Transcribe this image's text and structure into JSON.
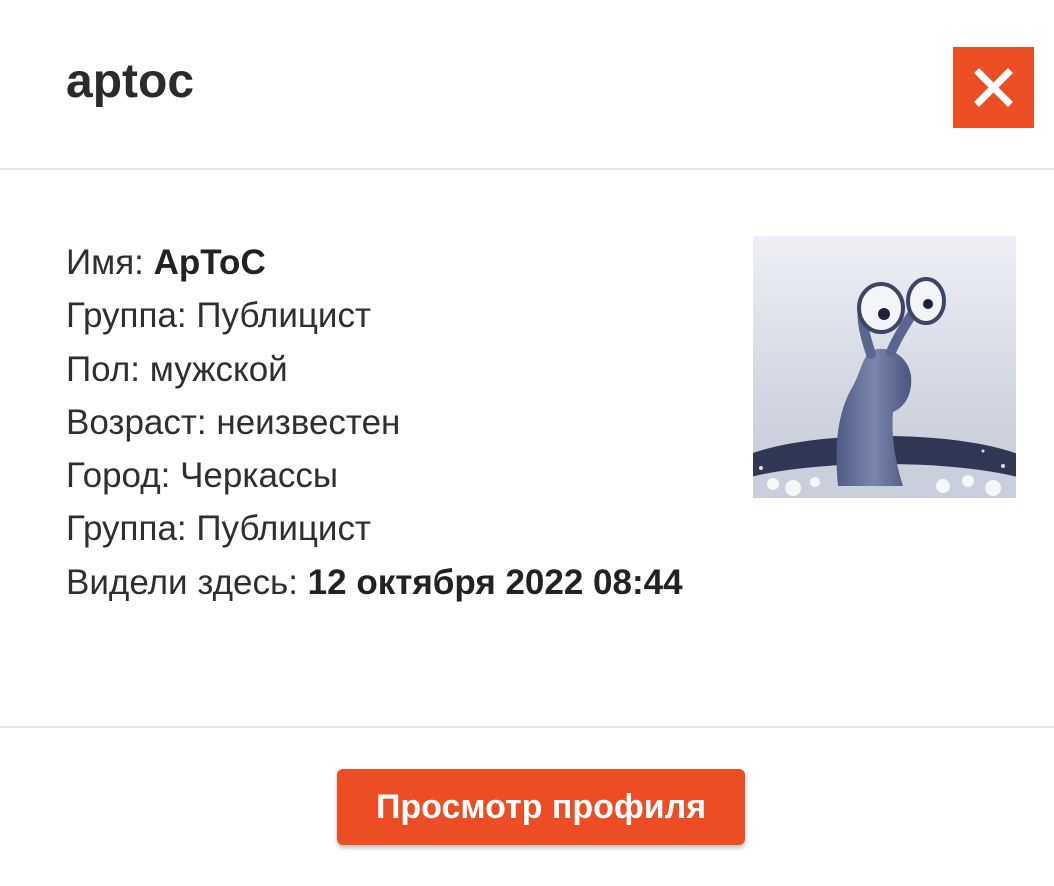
{
  "header": {
    "title": "aptoc"
  },
  "profile": {
    "rows": [
      {
        "label": "Имя: ",
        "value": "ApToC",
        "bold": true
      },
      {
        "label": "Группа: ",
        "value": "Публицист",
        "bold": false
      },
      {
        "label": "Пол: ",
        "value": "мужской",
        "bold": false
      },
      {
        "label": "Возраст: ",
        "value": "неизвестен",
        "bold": false
      },
      {
        "label": "Город: ",
        "value": "Черкассы",
        "bold": false
      },
      {
        "label": "Группа: ",
        "value": "Публицист",
        "bold": false
      },
      {
        "label": "Видели здесь: ",
        "value": "12 октября 2022 08:44",
        "bold": true
      }
    ],
    "avatar_icon": "snail-avatar"
  },
  "footer": {
    "view_profile_label": "Просмотр профиля"
  },
  "colors": {
    "accent": "#ec4d24",
    "divider": "#e6e6e6",
    "text": "#2f2f2f"
  }
}
